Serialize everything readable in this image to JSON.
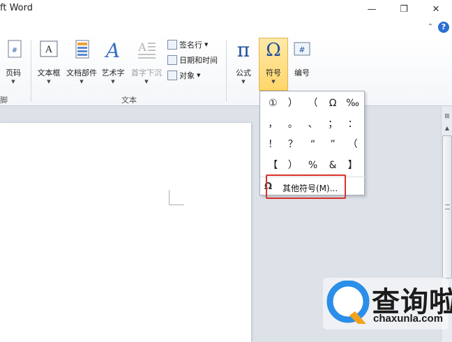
{
  "window": {
    "title": "ft Word",
    "minimize": "—",
    "restore": "❐",
    "close": "✕"
  },
  "help": {
    "collapse": "⌃",
    "help_label": "?"
  },
  "ribbon": {
    "buttons": [
      {
        "label": "页码",
        "icon": "page-number-icon"
      },
      {
        "label": "文本框",
        "icon": "textbox-icon"
      },
      {
        "label": "文档部件",
        "icon": "quick-parts-icon"
      },
      {
        "label": "艺术字",
        "icon": "wordart-icon"
      },
      {
        "label": "首字下沉",
        "icon": "drop-cap-icon"
      },
      {
        "label": "公式",
        "icon": "equation-icon"
      },
      {
        "label": "符号",
        "icon": "symbol-icon"
      },
      {
        "label": "编号",
        "icon": "number-icon"
      }
    ],
    "small_buttons": [
      {
        "label": "签名行",
        "icon": "signature-line-icon"
      },
      {
        "label": "日期和时间",
        "icon": "date-time-icon"
      },
      {
        "label": "对象",
        "icon": "object-icon"
      }
    ],
    "groups": {
      "left_partial": "脚",
      "text": "文本"
    },
    "caret": "▼"
  },
  "symbol_menu": {
    "rows": [
      [
        "①",
        "）",
        "（",
        "Ω",
        "‰"
      ],
      [
        "，",
        "。",
        "、",
        "；",
        "："
      ],
      [
        "！",
        "？",
        "“",
        "”",
        "（"
      ],
      [
        "【",
        "）",
        "%",
        "&",
        "】"
      ]
    ],
    "more_icon": "Ω",
    "more_label": "其他符号(M)..."
  },
  "scrollbar": {
    "ruler_icon": "⊞",
    "up_arrow": "▲"
  },
  "watermark": {
    "name": "查询啦",
    "url": "chaxunla.com"
  },
  "colors": {
    "accent_highlight": "#d9312a",
    "symbol_button_bg": "#ffd66a",
    "icon_blue": "#2d6fd1"
  }
}
